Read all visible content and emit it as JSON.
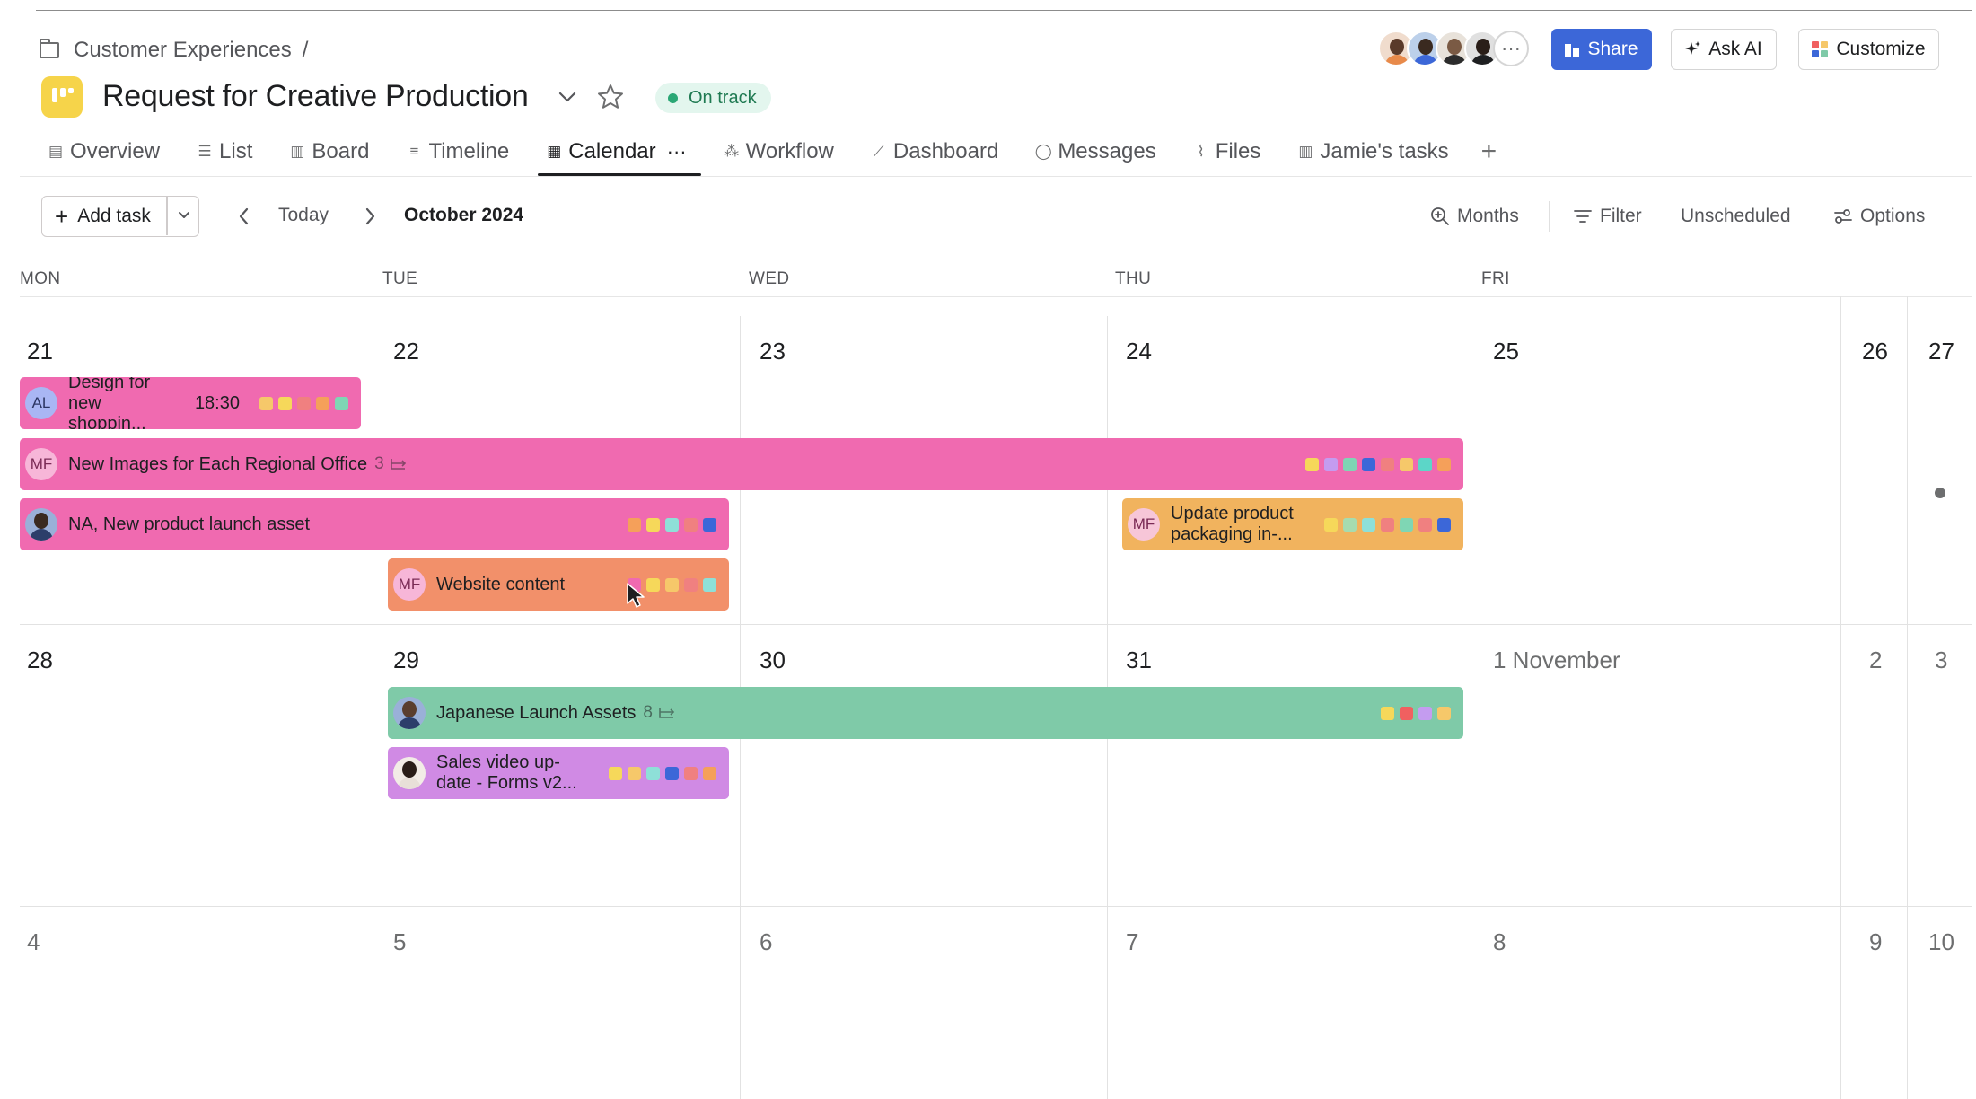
{
  "breadcrumb": {
    "parent": "Customer Experiences",
    "separator": "/"
  },
  "project": {
    "title": "Request for Creative Production",
    "status": "On track",
    "status_color": "#2aa775",
    "icon_color": "#f6d44a"
  },
  "header_buttons": {
    "share": "Share",
    "ask_ai": "Ask AI",
    "customize": "Customize"
  },
  "members_more": "···",
  "tabs": [
    {
      "label": "Overview",
      "icon": "clipboard-icon"
    },
    {
      "label": "List",
      "icon": "list-icon"
    },
    {
      "label": "Board",
      "icon": "board-icon"
    },
    {
      "label": "Timeline",
      "icon": "timeline-icon"
    },
    {
      "label": "Calendar",
      "icon": "calendar-icon",
      "active": true
    },
    {
      "label": "Workflow",
      "icon": "workflow-icon"
    },
    {
      "label": "Dashboard",
      "icon": "dashboard-icon"
    },
    {
      "label": "Messages",
      "icon": "message-icon"
    },
    {
      "label": "Files",
      "icon": "paperclip-icon"
    },
    {
      "label": "Jamie's tasks",
      "icon": "board-icon"
    }
  ],
  "tab_more": "···",
  "tab_add": "+",
  "toolbar": {
    "add_task": "Add task",
    "today": "Today",
    "month": "October 2024",
    "months": "Months",
    "filter": "Filter",
    "unscheduled": "Unscheduled",
    "options": "Options"
  },
  "weekdays": [
    "MON",
    "TUE",
    "WED",
    "THU",
    "FRI"
  ],
  "weeks": [
    [
      "21",
      "22",
      "23",
      "24",
      "25",
      "26",
      "27"
    ],
    [
      "28",
      "29",
      "30",
      "31",
      "1 November",
      "2",
      "3"
    ],
    [
      "4",
      "5",
      "6",
      "7",
      "8",
      "9",
      "10"
    ]
  ],
  "tasks": [
    {
      "id": "t1",
      "title": "Design for new shoppin...",
      "assignee": "AL",
      "time": "18:30",
      "color": "#f06ab0",
      "tags": [
        "#f6c86a",
        "#f6d85a",
        "#f08080",
        "#f5a05a",
        "#7fd6b4"
      ]
    },
    {
      "id": "t2",
      "title": "New Images for Each Regional Office",
      "assignee": "MF",
      "subtasks": "3",
      "color": "#f06ab0",
      "tags": [
        "#f6d85a",
        "#c49cf0",
        "#7fd6b4",
        "#3c67d8",
        "#f08080",
        "#f6c86a",
        "#5cd6c8",
        "#f5a05a"
      ]
    },
    {
      "id": "t3",
      "title": "NA, New product launch asset",
      "assignee": "photo",
      "color": "#f06ab0",
      "tags": [
        "#f5a05a",
        "#f6d85a",
        "#8ee0d8",
        "#f08080",
        "#3c67d8"
      ]
    },
    {
      "id": "t4",
      "title": "Update product packaging in-...",
      "assignee": "MF",
      "color": "#f1b35e",
      "tags": [
        "#f6d85a",
        "#a6dcb0",
        "#8ee0d8",
        "#f08080",
        "#7fd6b4",
        "#f08080",
        "#3c67d8"
      ]
    },
    {
      "id": "t5",
      "title": "Website content",
      "assignee": "MF",
      "color": "#f2906a",
      "tags": [
        "#f06ab0",
        "#f6d85a",
        "#f6c86a",
        "#f08080",
        "#8ee0d8"
      ]
    },
    {
      "id": "t6",
      "title": "Japanese Launch Assets",
      "assignee": "photo",
      "subtasks": "8",
      "color": "#7fcaa8",
      "tags": [
        "#f6d85a",
        "#f06060",
        "#c49cf0",
        "#f6c86a"
      ]
    },
    {
      "id": "t7",
      "title": "Sales video up-date - Forms v2...",
      "assignee": "photo",
      "color": "#d08ae4",
      "tags": [
        "#f6d85a",
        "#f6c86a",
        "#8ee0d8",
        "#3c67d8",
        "#f08080",
        "#f5a05a"
      ]
    }
  ]
}
